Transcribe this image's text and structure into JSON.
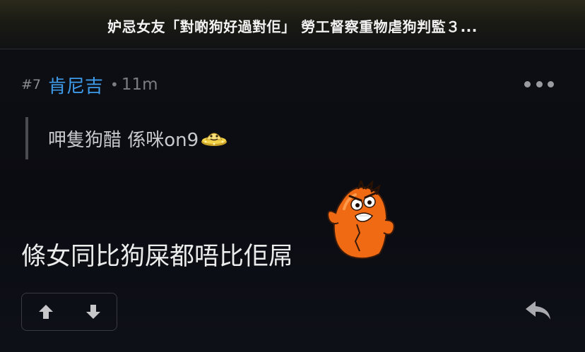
{
  "header": {
    "title": "妒忌女友「對啲狗好過對佢」 勞工督察重物虐狗判監３..."
  },
  "post": {
    "number": "#7",
    "username": "肯尼吉",
    "separator": "•",
    "time": "11m",
    "quote": "呷隻狗醋 係咪on9",
    "body": "條女同比狗屎都唔比佢屌"
  },
  "icons": {
    "more": "more-horizontal-icon",
    "quote_emoji": "ufo-emoji-icon",
    "mascot": "angry-orange-mascot-sticker",
    "upvote": "arrow-up-icon",
    "downvote": "arrow-down-icon",
    "reply": "reply-arrow-icon"
  },
  "colors": {
    "background": "#0c0d12",
    "username": "#3d9be9",
    "muted": "#7c7c82",
    "mascot_orange": "#f06a14"
  }
}
